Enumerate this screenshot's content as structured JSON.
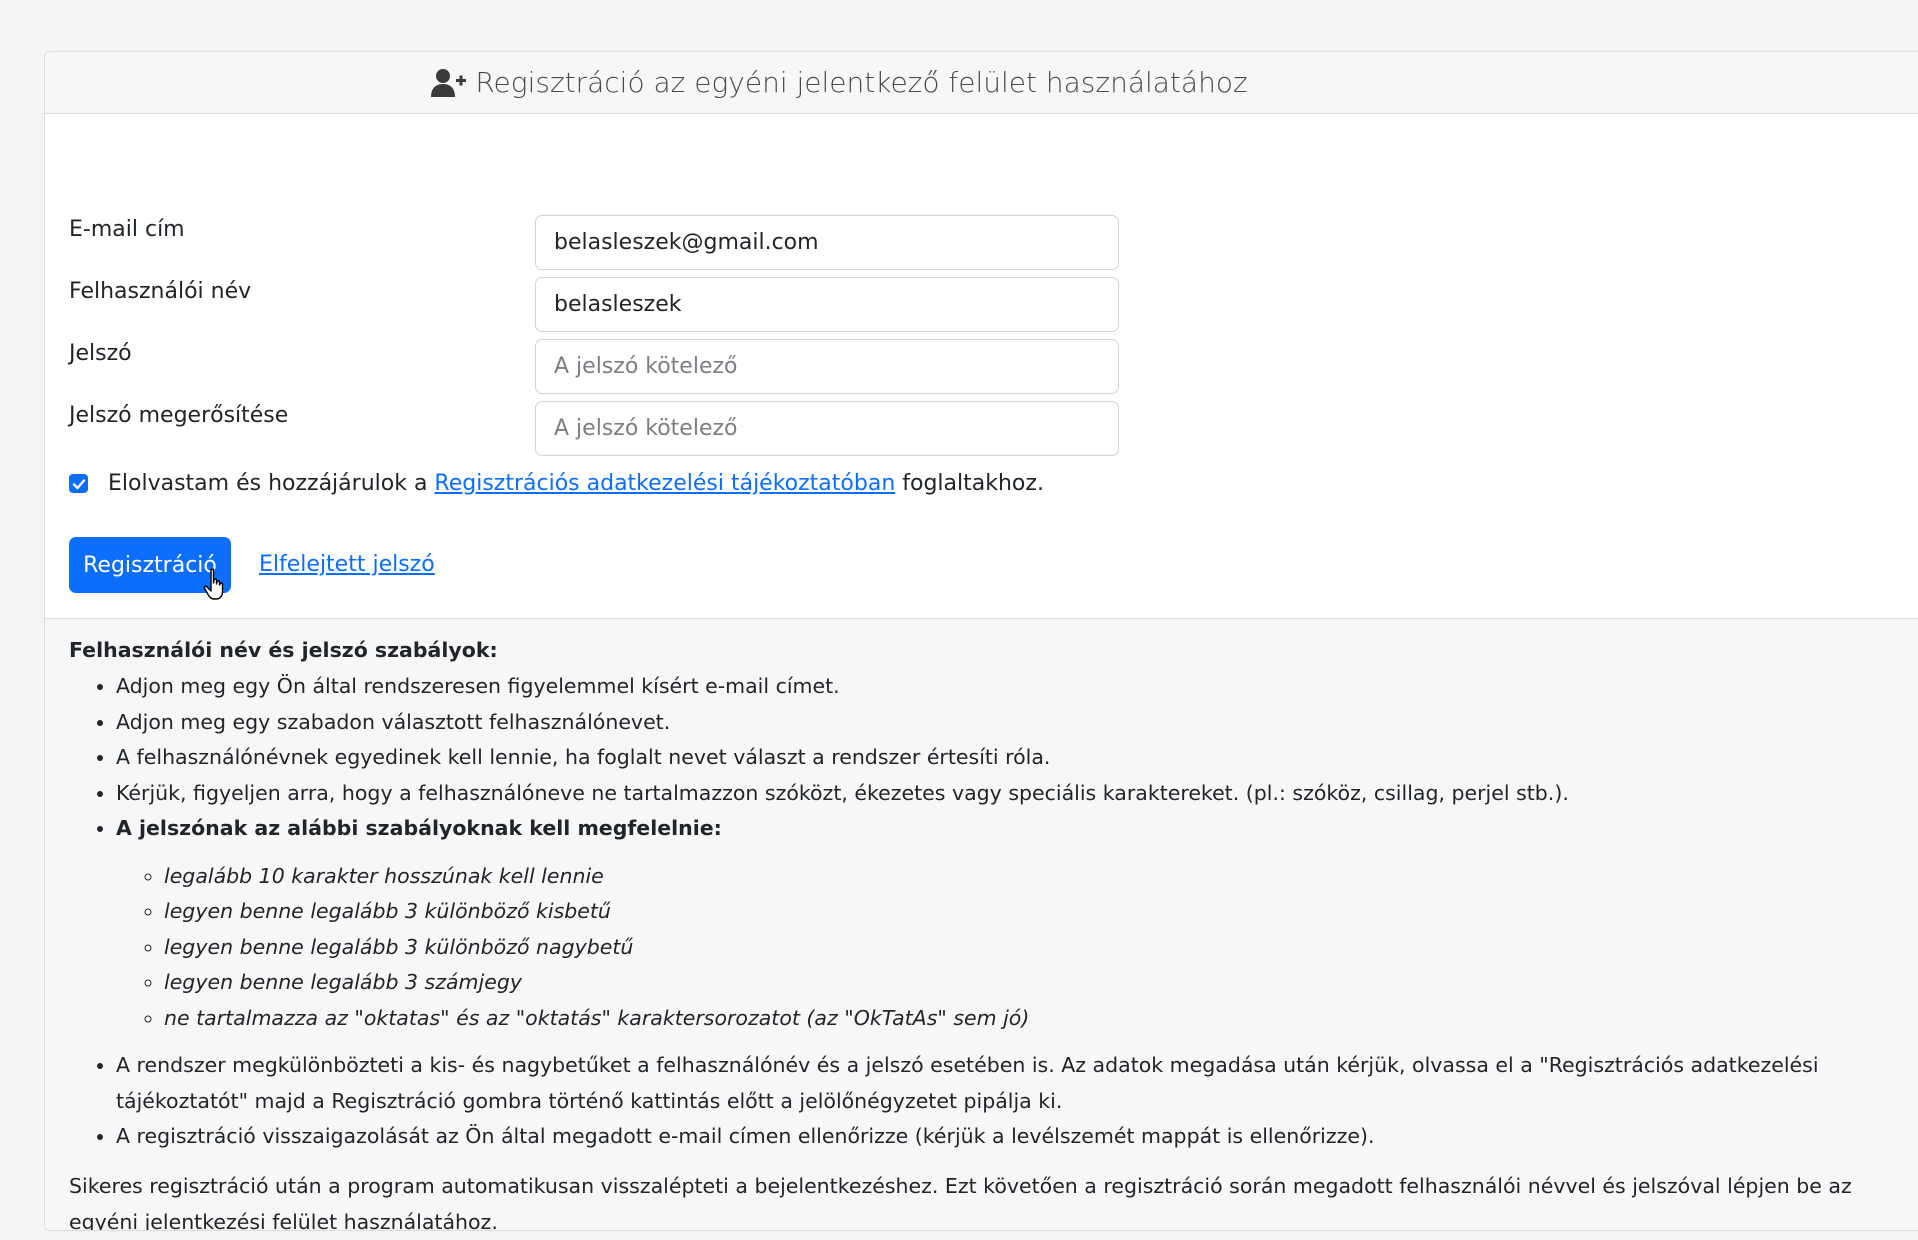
{
  "header": {
    "title": "Regisztráció az egyéni jelentkező felület használatához",
    "icon": "user-plus-icon"
  },
  "form": {
    "email": {
      "label": "E-mail cím",
      "value": "belasleszek@gmail.com"
    },
    "username": {
      "label": "Felhasználói név",
      "value": "belasleszek"
    },
    "password": {
      "label": "Jelszó",
      "placeholder": "A jelszó kötelező"
    },
    "password_confirm": {
      "label": "Jelszó megerősítése",
      "placeholder": "A jelszó kötelező"
    },
    "consent": {
      "checked": true,
      "text_before": "Elolvastam és hozzájárulok a",
      "link_text": "Regisztrációs adatkezelési tájékoztatóban",
      "text_after": "foglaltakhoz."
    },
    "submit_label": "Regisztráció",
    "forgot_password_label": "Elfelejtett jelszó"
  },
  "rules": {
    "title": "Felhasználói név és jelszó szabályok:",
    "items": [
      "Adjon meg egy Ön által rendszeresen figyelemmel kísért e-mail címet.",
      "Adjon meg egy szabadon választott felhasználónevet.",
      "A felhasználónévnek egyedinek kell lennie, ha foglalt nevet választ a rendszer értesíti róla.",
      "Kérjük, figyeljen arra, hogy a felhasználóneve ne tartalmazzon szóközt, ékezetes vagy speciális karaktereket. (pl.: szóköz, csillag, perjel stb.).",
      "A jelszónak az alábbi szabályoknak kell megfelelnie:",
      "A rendszer megkülönbözteti a kis- és nagybetűket a felhasználónév és a jelszó esetében is. Az adatok megadása után kérjük, olvassa el a \"Regisztrációs adatkezelési tájékoztatót\" majd a Regisztráció gombra történő kattintás előtt a jelölőnégyzetet pipálja ki.",
      "A regisztráció visszaigazolását az Ön által megadott e-mail címen ellenőrizze (kérjük a levélszemét mappát is ellenőrizze)."
    ],
    "password_rules": [
      "legalább 10 karakter hosszúnak kell lennie",
      "legyen benne legalább 3 különböző kisbetű",
      "legyen benne legalább 3 különböző nagybetű",
      "legyen benne legalább 3 számjegy",
      "ne tartalmazza az \"oktatas\" és az \"oktatás\" karaktersorozatot (az \"OkTatAs\" sem jó)"
    ]
  },
  "closing_text": "Sikeres regisztráció után a program automatikusan visszalépteti a bejelentkezéshez. Ezt követően a regisztráció során megadott felhasználói névvel és jelszóval lépjen be az egyéni jelentkezési felület használatához.",
  "colors": {
    "primary": "#0d6efd",
    "header_bg": "#f7f7f7",
    "page_bg": "#f4f4f4"
  }
}
